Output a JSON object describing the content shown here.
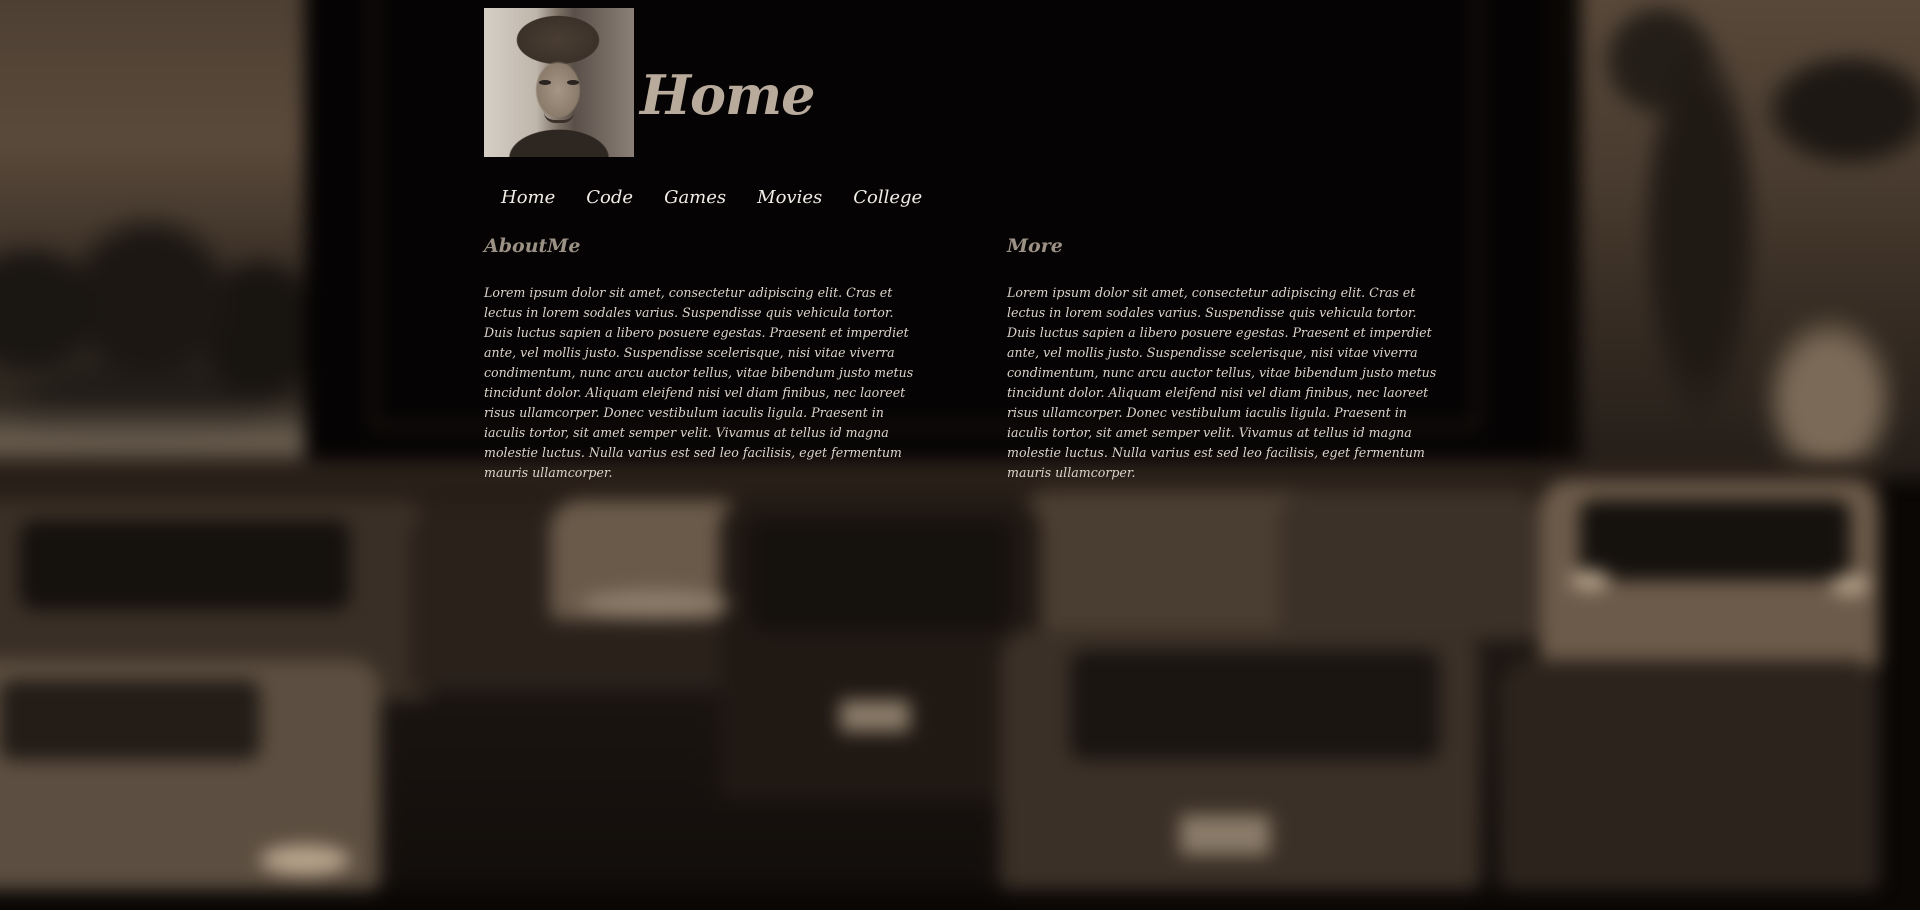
{
  "page": {
    "title": "Home"
  },
  "header": {
    "avatar_label": "profile-photo"
  },
  "nav": {
    "items": [
      {
        "label": "Home"
      },
      {
        "label": "Code"
      },
      {
        "label": "Games"
      },
      {
        "label": "Movies"
      },
      {
        "label": "College"
      }
    ]
  },
  "sections": [
    {
      "heading": "AboutMe",
      "body": "Lorem ipsum dolor sit amet, consectetur adipiscing elit. Cras et lectus in lorem sodales varius. Suspendisse quis vehicula tortor. Duis luctus sapien a libero posuere egestas. Praesent et imperdiet ante, vel mollis justo. Suspendisse scelerisque, nisi vitae viverra condimentum, nunc arcu auctor tellus, vitae bibendum justo metus tincidunt dolor. Aliquam eleifend nisi vel diam finibus, nec laoreet risus ullamcorper. Donec vestibulum iaculis ligula. Praesent in iaculis tortor, sit amet semper velit. Vivamus at tellus id magna molestie luctus. Nulla varius est sed leo facilisis, eget fermentum mauris ullamcorper."
    },
    {
      "heading": "More",
      "body": "Lorem ipsum dolor sit amet, consectetur adipiscing elit. Cras et lectus in lorem sodales varius. Suspendisse quis vehicula tortor. Duis luctus sapien a libero posuere egestas. Praesent et imperdiet ante, vel mollis justo. Suspendisse scelerisque, nisi vitae viverra condimentum, nunc arcu auctor tellus, vitae bibendum justo metus tincidunt dolor. Aliquam eleifend nisi vel diam finibus, nec laoreet risus ullamcorper. Donec vestibulum iaculis ligula. Praesent in iaculis tortor, sit amet semper velit. Vivamus at tellus id magna molestie luctus. Nulla varius est sed leo facilisis, eget fermentum mauris ullamcorper."
    }
  ],
  "colors": {
    "title": "#b9ab9b",
    "nav_text": "#f2ece6",
    "heading": "#9c9185",
    "body_text": "#dcd4cb",
    "background": "#0a0705"
  }
}
